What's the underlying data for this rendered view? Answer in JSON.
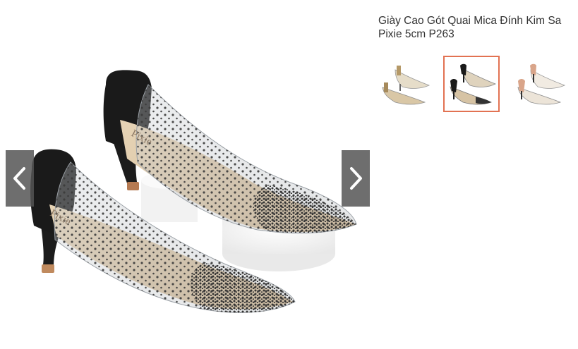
{
  "product": {
    "title": "Giày Cao Gót Quai Mica Đính Kim Sa Pixie 5cm P263"
  },
  "gallery": {
    "prev_icon": "chevron-left-icon",
    "next_icon": "chevron-right-icon",
    "active_thumbnail": 2,
    "thumbnails": [
      {
        "icon": "shoe-gold-photo",
        "active": false
      },
      {
        "icon": "shoe-black-photo",
        "active": true
      },
      {
        "icon": "shoe-nude-photo",
        "active": false
      }
    ],
    "main_image": {
      "brand_print": "Pixie"
    }
  },
  "colors": {
    "active_border": "#e27252",
    "nav_button_bg": "#555555",
    "title_text": "#333333"
  }
}
